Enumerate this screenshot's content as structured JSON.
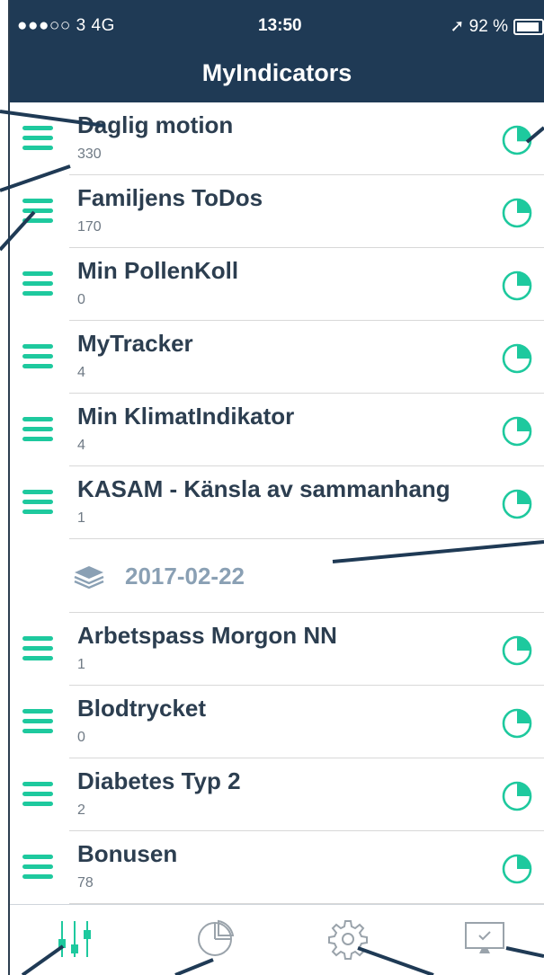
{
  "status_bar": {
    "carrier": "●●●○○ 3   4G",
    "time": "13:50",
    "battery": "➚ 92 %"
  },
  "nav": {
    "title": "MyIndicators"
  },
  "rows_top": [
    {
      "title": "Daglig motion",
      "value": "330"
    },
    {
      "title": "Familjens ToDos",
      "value": "170"
    },
    {
      "title": "Min PollenKoll",
      "value": "0"
    },
    {
      "title": "MyTracker",
      "value": "4"
    },
    {
      "title": "Min KlimatIndikator",
      "value": "4"
    },
    {
      "title": "KASAM - Känsla av sammanhang",
      "value": "1"
    }
  ],
  "group": {
    "date": "2017-02-22"
  },
  "rows_bottom": [
    {
      "title": "Arbetspass Morgon NN",
      "value": "1"
    },
    {
      "title": "Blodtrycket",
      "value": "0"
    },
    {
      "title": "Diabetes Typ 2",
      "value": "2"
    },
    {
      "title": "Bonusen",
      "value": "78"
    }
  ],
  "tabs": [
    "indicators-tab",
    "stats-tab",
    "settings-tab",
    "dashboard-tab"
  ],
  "colors": {
    "accent": "#1ec99e",
    "navy": "#1f3a55",
    "text": "#2c3e50",
    "muted": "#8aa0b4"
  }
}
